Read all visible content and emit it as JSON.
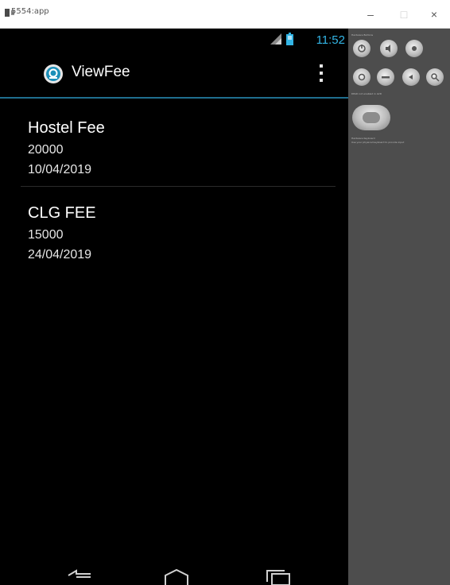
{
  "window": {
    "title": "5554:app",
    "controls": {
      "minimize": "–",
      "maximize": "□",
      "close": "×"
    }
  },
  "statusbar": {
    "time": "11:52",
    "signal_icon": "signal-icon",
    "battery_icon": "battery-icon"
  },
  "actionbar": {
    "title": "ViewFee",
    "overflow_icon": "overflow-menu-icon",
    "accent": "#33b5e5"
  },
  "fees": [
    {
      "name": "Hostel Fee",
      "amount": "20000",
      "date": "10/04/2019"
    },
    {
      "name": "CLG FEE",
      "amount": "15000",
      "date": "24/04/2019"
    }
  ],
  "navbar": {
    "back_icon": "back-icon",
    "home_icon": "home-icon",
    "recents_icon": "recents-icon"
  },
  "side_panel": {
    "hardware_label": "Hardware Buttons",
    "dpad_label": "DPAD not enabled in AVD",
    "keyboard_label": "Hardware Keyboard",
    "keyboard_hint": "Use your physical keyboard to provide input"
  }
}
